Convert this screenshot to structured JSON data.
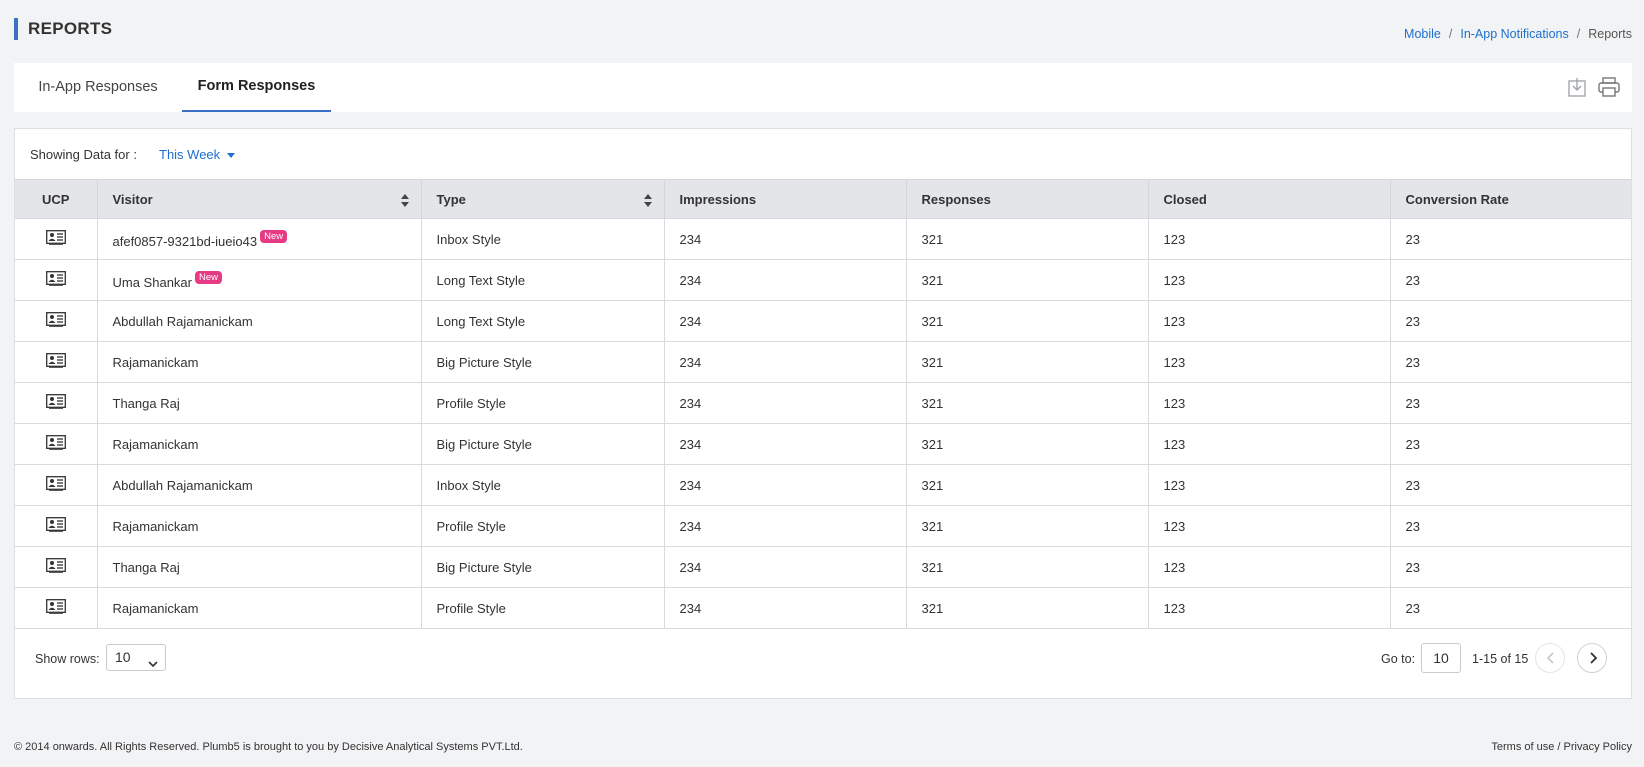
{
  "page": {
    "title": "REPORTS",
    "breadcrumb": [
      "Mobile",
      "In-App Notifications",
      "Reports"
    ]
  },
  "tabs": [
    "In-App Responses",
    "Form Responses"
  ],
  "active_tab": "Form Responses",
  "toolbar": {
    "download_icon": "download-icon",
    "print_icon": "print-icon"
  },
  "filter": {
    "label": "Showing Data for :",
    "value": "This Week"
  },
  "table": {
    "columns": [
      "UCP",
      "Visitor",
      "Type",
      "Impressions",
      "Responses",
      "Closed",
      "Conversion Rate"
    ],
    "new_badge": "New",
    "rows": [
      {
        "visitor": "afef0857-9321bd-iueio43",
        "is_new": true,
        "type": "Inbox Style",
        "impressions": "234",
        "responses": "321",
        "closed": "123",
        "conversion_rate": "23"
      },
      {
        "visitor": "Uma Shankar",
        "is_new": true,
        "type": "Long Text Style",
        "impressions": "234",
        "responses": "321",
        "closed": "123",
        "conversion_rate": "23"
      },
      {
        "visitor": "Abdullah Rajamanickam",
        "is_new": false,
        "type": "Long Text Style",
        "impressions": "234",
        "responses": "321",
        "closed": "123",
        "conversion_rate": "23"
      },
      {
        "visitor": "Rajamanickam",
        "is_new": false,
        "type": "Big Picture Style",
        "impressions": "234",
        "responses": "321",
        "closed": "123",
        "conversion_rate": "23"
      },
      {
        "visitor": "Thanga Raj",
        "is_new": false,
        "type": "Profile Style",
        "impressions": "234",
        "responses": "321",
        "closed": "123",
        "conversion_rate": "23"
      },
      {
        "visitor": "Rajamanickam",
        "is_new": false,
        "type": "Big Picture Style",
        "impressions": "234",
        "responses": "321",
        "closed": "123",
        "conversion_rate": "23"
      },
      {
        "visitor": "Abdullah Rajamanickam",
        "is_new": false,
        "type": "Inbox Style",
        "impressions": "234",
        "responses": "321",
        "closed": "123",
        "conversion_rate": "23"
      },
      {
        "visitor": "Rajamanickam",
        "is_new": false,
        "type": "Profile Style",
        "impressions": "234",
        "responses": "321",
        "closed": "123",
        "conversion_rate": "23"
      },
      {
        "visitor": "Thanga Raj",
        "is_new": false,
        "type": "Big Picture Style",
        "impressions": "234",
        "responses": "321",
        "closed": "123",
        "conversion_rate": "23"
      },
      {
        "visitor": "Rajamanickam",
        "is_new": false,
        "type": "Profile Style",
        "impressions": "234",
        "responses": "321",
        "closed": "123",
        "conversion_rate": "23"
      }
    ]
  },
  "pagination": {
    "show_rows_label": "Show rows:",
    "show_rows_value": "10",
    "goto_label": "Go to:",
    "goto_value": "10",
    "range_text": "1-15 of 15"
  },
  "footer": {
    "copyright": "© 2014 onwards. All Rights Reserved. Plumb5 is brought to you by Decisive Analytical Systems PVT.Ltd.",
    "terms": "Terms of use",
    "separator": " / ",
    "privacy": "Privacy Policy"
  },
  "colors": {
    "accent": "#3a6fc5",
    "link": "#1f6fd0",
    "new_badge": "#e73a84",
    "header_bg": "#e3e5e9"
  }
}
